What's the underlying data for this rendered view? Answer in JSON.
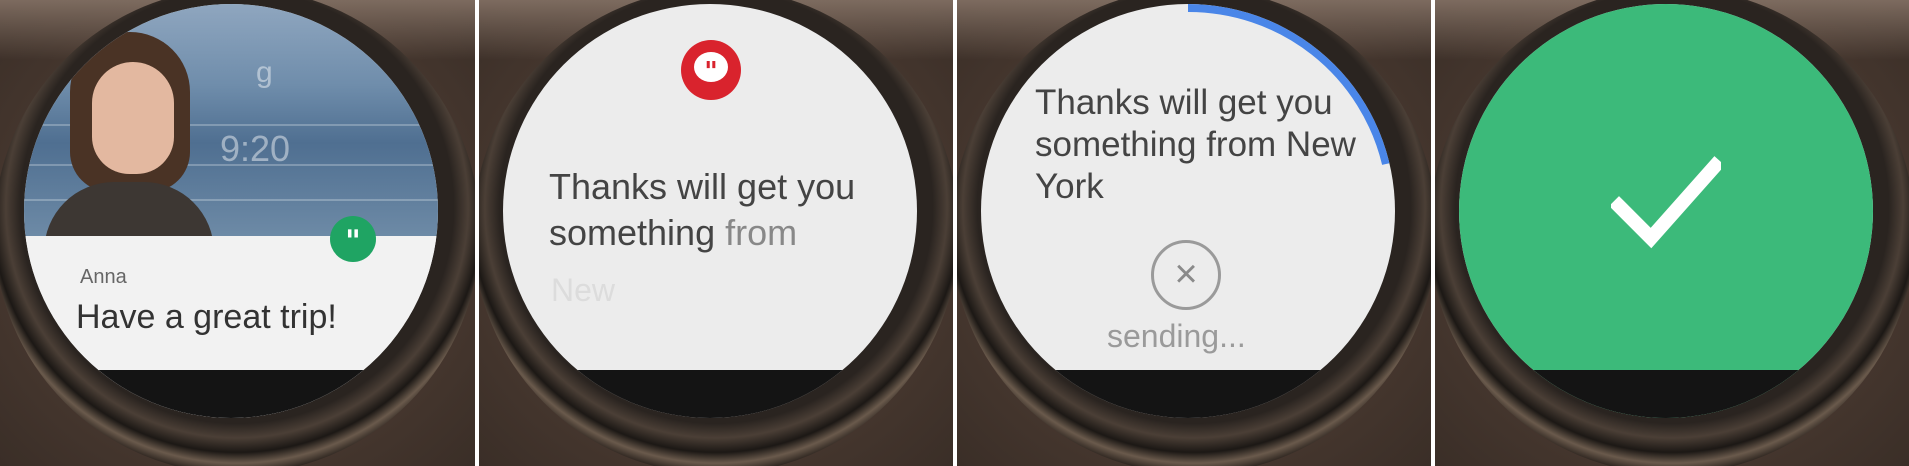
{
  "frames": {
    "incoming": {
      "watch_time": "9:20",
      "watch_logo": "g",
      "sender": "Anna",
      "message": "Have a great trip!",
      "app_icon": "hangouts-icon",
      "app_color": "#1fa463"
    },
    "dictation": {
      "app_icon": "hangouts-icon",
      "app_color": "#d9232d",
      "text_main": "Thanks will get you something",
      "text_partial": "from",
      "text_pending": "New"
    },
    "sending": {
      "text": "Thanks will get you something from New York",
      "cancel_icon": "close-icon",
      "status": "sending...",
      "progress_color": "#4a86e8"
    },
    "confirmation": {
      "icon": "checkmark-icon",
      "background_color": "#3cba7a"
    }
  }
}
